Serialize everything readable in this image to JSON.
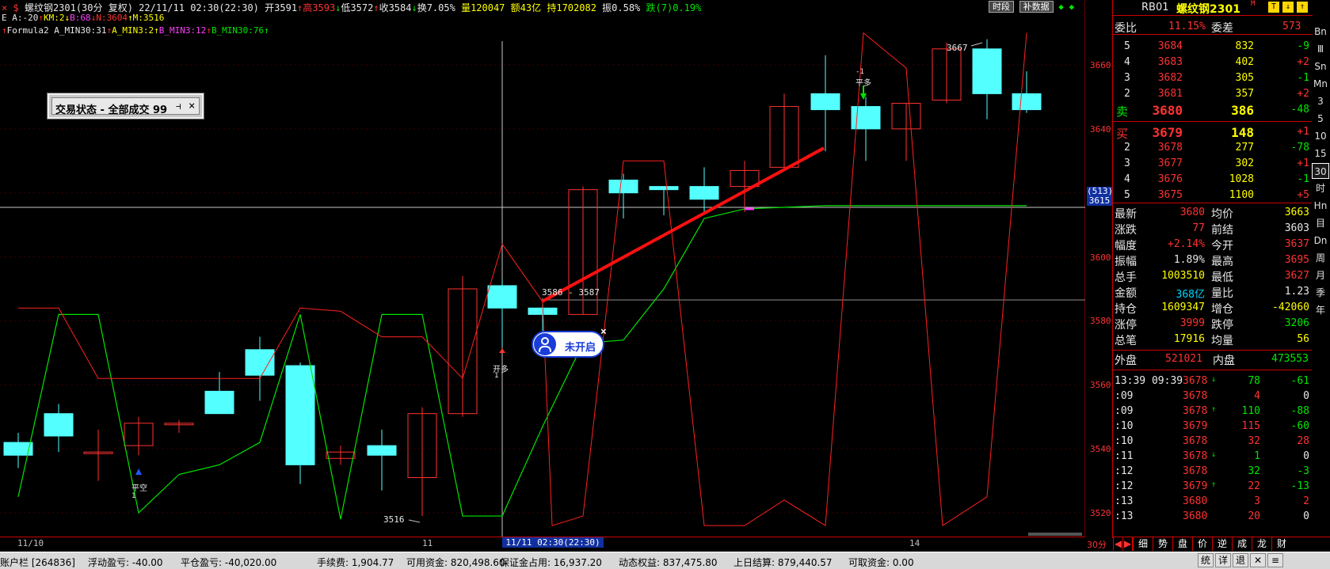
{
  "header": {
    "title": "螺纹钢2301(30分 复权) 22/11/11 02:30(22:30)",
    "open": "开3591",
    "high": "高3593",
    "low": "低3572",
    "close": "收3584",
    "turnover_rate": "换7.05%",
    "volume": "量120047",
    "amount": "额43亿",
    "open_interest": "持1702082",
    "amplitude": "振0.58%",
    "change": "跌(7)0.19%",
    "btn_time": "时段",
    "btn_fill": "补数据"
  },
  "indicator_row1": {
    "e": "E A:-20",
    "km": "KM:2",
    "b": "B:68",
    "n": "N:3604",
    "m": "M:3516"
  },
  "indicator_row2": {
    "name": "Formula2",
    "a": "A_MIN30:31",
    "a2": "A_MIN3:2",
    "b": "B_MIN3:12",
    "bmin30": "B_MIN30:76"
  },
  "trade_popup": {
    "label": "交易状态 - 全部成交 99",
    "pin": "ㅁ",
    "close": "×"
  },
  "overlay_badge": {
    "label": "未开启",
    "close": "×"
  },
  "y_axis": [
    "3660",
    "3640",
    "3620",
    "3600",
    "3580",
    "3560",
    "3540",
    "3520"
  ],
  "crosshair": {
    "price_tag": "3615",
    "sub_tag": "(513)"
  },
  "annotations": {
    "hi": "3667",
    "lo": "3516",
    "range": "3586 - 3587",
    "open_long": "开多",
    "open_long_n": "1",
    "close_short": "平空",
    "close_short_n": "1",
    "close_long": "平多",
    "close_long_n": "-1"
  },
  "x_axis": {
    "d1": "11/10",
    "d2": "11",
    "cursor": "11/11 02:30(22:30)",
    "d3": "14",
    "period": "30分"
  },
  "quote_panel": {
    "code": "RB01",
    "name": "螺纹钢2301",
    "mark": "M",
    "weibi_label": "委比",
    "weibi": "11.15%",
    "weicha_label": "委差",
    "weicha": "573"
  },
  "asks": [
    {
      "lvl": "5",
      "price": "3684",
      "vol": "832",
      "chg": "-9"
    },
    {
      "lvl": "4",
      "price": "3683",
      "vol": "402",
      "chg": "+2"
    },
    {
      "lvl": "3",
      "price": "3682",
      "vol": "305",
      "chg": "-1"
    },
    {
      "lvl": "2",
      "price": "3681",
      "vol": "357",
      "chg": "+2"
    },
    {
      "lvl": "卖",
      "price": "3680",
      "vol": "386",
      "chg": "-48"
    }
  ],
  "bids": [
    {
      "lvl": "买",
      "price": "3679",
      "vol": "148",
      "chg": "+1"
    },
    {
      "lvl": "2",
      "price": "3678",
      "vol": "277",
      "chg": "-78"
    },
    {
      "lvl": "3",
      "price": "3677",
      "vol": "302",
      "chg": "+1"
    },
    {
      "lvl": "4",
      "price": "3676",
      "vol": "1028",
      "chg": "-1"
    },
    {
      "lvl": "5",
      "price": "3675",
      "vol": "1100",
      "chg": "+5"
    }
  ],
  "stats": [
    {
      "l1": "最新",
      "v1": "3680",
      "l2": "均价",
      "v2": "3663"
    },
    {
      "l1": "涨跌",
      "v1": "77",
      "l2": "前结",
      "v2": "3603"
    },
    {
      "l1": "幅度",
      "v1": "+2.14%",
      "l2": "今开",
      "v2": "3637"
    },
    {
      "l1": "振幅",
      "v1": "1.89%",
      "l2": "最高",
      "v2": "3695"
    },
    {
      "l1": "总手",
      "v1": "1003510",
      "l2": "最低",
      "v2": "3627"
    },
    {
      "l1": "金额",
      "v1": "368亿",
      "l2": "量比",
      "v2": "1.23"
    },
    {
      "l1": "持仓",
      "v1": "1609347",
      "l2": "增仓",
      "v2": "-42060"
    },
    {
      "l1": "涨停",
      "v1": "3999",
      "l2": "跌停",
      "v2": "3206"
    },
    {
      "l1": "总笔",
      "v1": "17916",
      "l2": "均量",
      "v2": "56"
    }
  ],
  "outer_inner": {
    "outer_label": "外盘",
    "outer": "521021",
    "inner_label": "内盘",
    "inner": "473553"
  },
  "ticks": [
    {
      "time": "13:39 09:39",
      "price": "3678",
      "arrow": "↓",
      "vol": "78",
      "chg": "-61"
    },
    {
      "time": ":09",
      "price": "3678",
      "arrow": "",
      "vol": "4",
      "chg": "0"
    },
    {
      "time": ":09",
      "price": "3678",
      "arrow": "↑",
      "vol": "110",
      "chg": "-88"
    },
    {
      "time": ":10",
      "price": "3679",
      "arrow": "",
      "vol": "115",
      "chg": "-60"
    },
    {
      "time": ":10",
      "price": "3678",
      "arrow": "",
      "vol": "32",
      "chg": "28"
    },
    {
      "time": ":11",
      "price": "3678",
      "arrow": "↓",
      "vol": "1",
      "chg": "0"
    },
    {
      "time": ":12",
      "price": "3678",
      "arrow": "",
      "vol": "32",
      "chg": "-3"
    },
    {
      "time": ":12",
      "price": "3679",
      "arrow": "↑",
      "vol": "22",
      "chg": "-13"
    },
    {
      "time": ":13",
      "price": "3680",
      "arrow": "",
      "vol": "3",
      "chg": "2"
    },
    {
      "time": ":13",
      "price": "3680",
      "arrow": "",
      "vol": "20",
      "chg": "0"
    }
  ],
  "side_buttons": [
    "Bn",
    "Ⅲ",
    "Sn",
    "Mn",
    "3",
    "5",
    "10",
    "15",
    "30",
    "时",
    "Hn",
    "目",
    "Dn",
    "周",
    "月",
    "季",
    "年"
  ],
  "bottom_tabs": [
    "细",
    "势",
    "盘",
    "价",
    "逆",
    "成",
    "龙",
    "财"
  ],
  "status_bar": {
    "account": "账户栏 [264836]",
    "float_pnl": "浮动盈亏: -40.00",
    "close_pnl": "平仓盈亏: -40,020.00",
    "fee": "手续费: 1,904.77",
    "available": "可用资金: 820,498.60",
    "margin": "保证金占用: 16,937.20",
    "equity": "动态权益: 837,475.80",
    "prev_settle": "上日结算: 879,440.57",
    "withdrawable": "可取资金: 0.00",
    "btn_list": "统",
    "btn_detail": "详",
    "btn_back": "退",
    "btn_tool": "✕",
    "btn_menu": "≡"
  },
  "colors": {
    "up": "#ff3232",
    "down_fill": "#54ffff",
    "ma_green": "#00e600",
    "ma_red": "#ff2020",
    "trend": "#ff1010"
  }
}
